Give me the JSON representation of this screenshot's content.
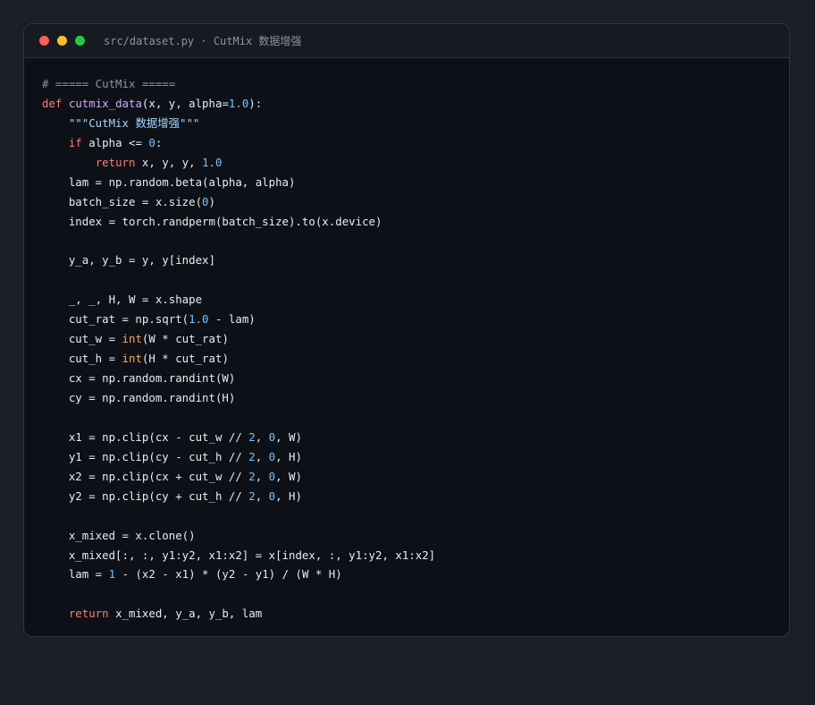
{
  "window": {
    "title": "src/dataset.py · CutMix 数据增强"
  },
  "code": {
    "lines": [
      [
        {
          "t": "# ===== CutMix =====",
          "c": "cm"
        }
      ],
      [
        {
          "t": "def",
          "c": "kw"
        },
        {
          "t": " "
        },
        {
          "t": "cutmix_data",
          "c": "fn"
        },
        {
          "t": "(x, y, alpha="
        },
        {
          "t": "1.0",
          "c": "num"
        },
        {
          "t": "):"
        }
      ],
      [
        {
          "t": "    "
        },
        {
          "t": "\"\"\"CutMix 数据增强\"\"\"",
          "c": "str"
        }
      ],
      [
        {
          "t": "    "
        },
        {
          "t": "if",
          "c": "kw"
        },
        {
          "t": " alpha <= "
        },
        {
          "t": "0",
          "c": "num"
        },
        {
          "t": ":"
        }
      ],
      [
        {
          "t": "        "
        },
        {
          "t": "return",
          "c": "kw"
        },
        {
          "t": " x, y, y, "
        },
        {
          "t": "1.0",
          "c": "num"
        }
      ],
      [
        {
          "t": "    lam = np.random.beta(alpha, alpha)"
        }
      ],
      [
        {
          "t": "    batch_size = x.size("
        },
        {
          "t": "0",
          "c": "num"
        },
        {
          "t": ")"
        }
      ],
      [
        {
          "t": "    index = torch.randperm(batch_size).to(x.device)"
        }
      ],
      [],
      [
        {
          "t": "    y_a, y_b = y, y[index]"
        }
      ],
      [],
      [
        {
          "t": "    _, _, H, W = x.shape"
        }
      ],
      [
        {
          "t": "    cut_rat = np.sqrt("
        },
        {
          "t": "1.0",
          "c": "num"
        },
        {
          "t": " - lam)"
        }
      ],
      [
        {
          "t": "    cut_w = "
        },
        {
          "t": "int",
          "c": "bi"
        },
        {
          "t": "(W * cut_rat)"
        }
      ],
      [
        {
          "t": "    cut_h = "
        },
        {
          "t": "int",
          "c": "bi"
        },
        {
          "t": "(H * cut_rat)"
        }
      ],
      [
        {
          "t": "    cx = np.random.randint(W)"
        }
      ],
      [
        {
          "t": "    cy = np.random.randint(H)"
        }
      ],
      [],
      [
        {
          "t": "    x1 = np.clip(cx - cut_w // "
        },
        {
          "t": "2",
          "c": "num"
        },
        {
          "t": ", "
        },
        {
          "t": "0",
          "c": "num"
        },
        {
          "t": ", W)"
        }
      ],
      [
        {
          "t": "    y1 = np.clip(cy - cut_h // "
        },
        {
          "t": "2",
          "c": "num"
        },
        {
          "t": ", "
        },
        {
          "t": "0",
          "c": "num"
        },
        {
          "t": ", H)"
        }
      ],
      [
        {
          "t": "    x2 = np.clip(cx + cut_w // "
        },
        {
          "t": "2",
          "c": "num"
        },
        {
          "t": ", "
        },
        {
          "t": "0",
          "c": "num"
        },
        {
          "t": ", W)"
        }
      ],
      [
        {
          "t": "    y2 = np.clip(cy + cut_h // "
        },
        {
          "t": "2",
          "c": "num"
        },
        {
          "t": ", "
        },
        {
          "t": "0",
          "c": "num"
        },
        {
          "t": ", H)"
        }
      ],
      [],
      [
        {
          "t": "    x_mixed = x.clone()"
        }
      ],
      [
        {
          "t": "    x_mixed[:, :, y1:y2, x1:x2] = x[index, :, y1:y2, x1:x2]"
        }
      ],
      [
        {
          "t": "    lam = "
        },
        {
          "t": "1",
          "c": "num"
        },
        {
          "t": " - (x2 - x1) * (y2 - y1) / (W * H)"
        }
      ],
      [],
      [
        {
          "t": "    "
        },
        {
          "t": "return",
          "c": "kw"
        },
        {
          "t": " x_mixed, y_a, y_b, lam"
        }
      ]
    ]
  }
}
